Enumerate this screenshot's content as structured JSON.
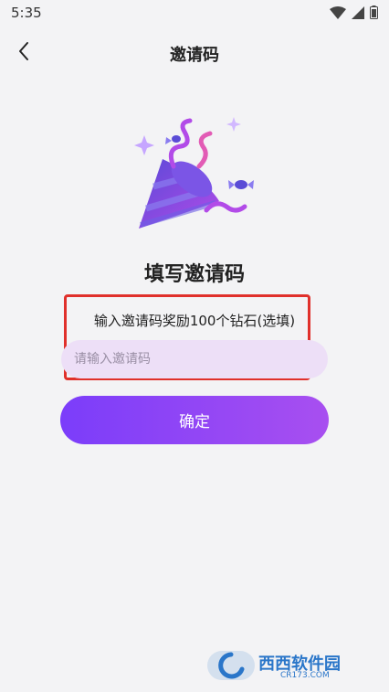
{
  "status_bar": {
    "time": "5:35",
    "icons": [
      "wifi-icon",
      "signal-icon",
      "battery-icon"
    ]
  },
  "nav": {
    "back_icon": "chevron-left-icon",
    "title": "邀请码"
  },
  "illustration": {
    "icon": "party-popper-icon"
  },
  "main": {
    "heading": "填写邀请码",
    "reward_text": "输入邀请码奖励100个钻石(选填)",
    "input": {
      "placeholder": "请输入邀请码",
      "value": ""
    },
    "confirm_label": "确定"
  },
  "watermark": {
    "main": "西西软件园",
    "sub": "CR173.COM"
  },
  "colors": {
    "background": "#f3f3f5",
    "button_gradient_start": "#7b3dfa",
    "button_gradient_end": "#a84ff0",
    "input_background": "#eddff7",
    "highlight_border": "#e0302b"
  }
}
